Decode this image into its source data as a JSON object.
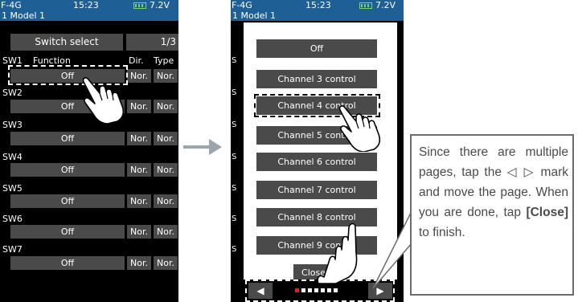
{
  "left_screen": {
    "status": {
      "signal": "F-4G",
      "time": "15:23",
      "voltage": "7.2V"
    },
    "model_label": "1  Model 1",
    "header": {
      "title": "Switch select",
      "page": "1/3"
    },
    "columns": {
      "sw": "SW1",
      "function": "Function",
      "dir": "Dir.",
      "type": "Type"
    },
    "rows": [
      {
        "sw": "",
        "function": "Off",
        "dir": "Nor.",
        "type": "Nor."
      },
      {
        "sw": "SW2",
        "function": "Off",
        "dir": "Nor.",
        "type": "Nor."
      },
      {
        "sw": "SW3",
        "function": "Off",
        "dir": "Nor.",
        "type": "Nor."
      },
      {
        "sw": "SW4",
        "function": "Off",
        "dir": "Nor.",
        "type": "Nor."
      },
      {
        "sw": "SW5",
        "function": "Off",
        "dir": "Nor.",
        "type": "Nor."
      },
      {
        "sw": "SW6",
        "function": "Off",
        "dir": "Nor.",
        "type": "Nor."
      },
      {
        "sw": "SW7",
        "function": "Off",
        "dir": "Nor.",
        "type": "Nor."
      }
    ]
  },
  "right_screen": {
    "status": {
      "signal": "F-4G",
      "time": "15:23",
      "voltage": "7.2V"
    },
    "model_label": "1  Model 1",
    "options": [
      "Off",
      "Channel 3 control",
      "Channel 4 control",
      "Channel 5 control",
      "Channel 6 control",
      "Channel 7 control",
      "Channel 8 control",
      "Channel 9 control"
    ],
    "close_label": "Close",
    "prev_label": "◀",
    "next_label": "▶",
    "page_indicator": {
      "pages": 7,
      "current": 1
    }
  },
  "callout": {
    "text_before": "Since there are multiple pages, tap the ◁ ▷ mark and move the page. When you are done, tap ",
    "close_word": "[Close]",
    "text_after": " to finish."
  },
  "colors": {
    "header_blue": "#1e5f96",
    "button_gray": "#4a4a4a",
    "indicator_red": "#e02020",
    "battery_green": "#7cd36e"
  }
}
